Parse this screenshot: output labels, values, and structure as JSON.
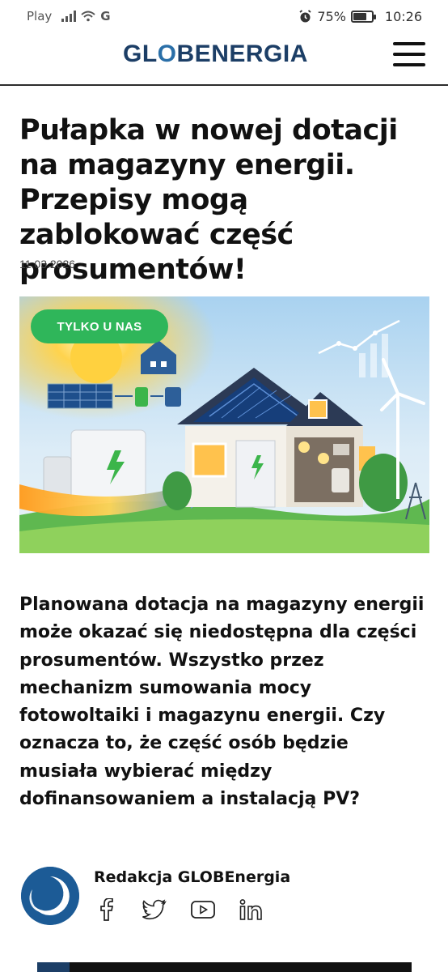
{
  "status_bar": {
    "carrier": "Play",
    "network": "G",
    "battery": "75%",
    "battery_level": 0.75,
    "time": "10:26",
    "icons": [
      "signal-icon",
      "wifi-icon",
      "alarm-icon",
      "battery-icon"
    ]
  },
  "header": {
    "logo_part1": "GL",
    "logo_o": "O",
    "logo_part2": "BENERGIA",
    "menu_icon": "hamburger-menu-icon"
  },
  "article": {
    "title": "Pułapka w nowej dotacji na magazyny energii. Przepisy mogą zablokować część prosumentów!",
    "date": "11.03.2026",
    "image_badge": "TYLKO U NAS",
    "lead": "Planowana dotacja na magazyny energii może okazać się niedostępna dla części prosumentów. Wszystko przez mechanizm sumowania mocy fotowoltaiki i magazynu energii. Czy oznacza to, że część osób będzie musiała wybierać między dofinansowaniem a instalacją PV?"
  },
  "author": {
    "name": "Redakcja GLOBEnergia",
    "socials": [
      "facebook-icon",
      "twitter-icon",
      "youtube-icon",
      "linkedin-icon"
    ]
  },
  "colors": {
    "brand": "#1c3e66",
    "badge": "#2fb65a",
    "text": "#111111"
  }
}
